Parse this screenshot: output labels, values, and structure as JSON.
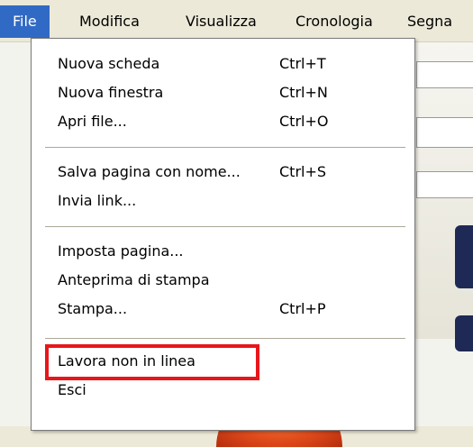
{
  "menubar": {
    "items": [
      {
        "label": "File"
      },
      {
        "label": "Modifica"
      },
      {
        "label": "Visualizza"
      },
      {
        "label": "Cronologia"
      },
      {
        "label": "Segna"
      }
    ]
  },
  "file_menu": {
    "groups": [
      [
        {
          "label": "Nuova scheda",
          "shortcut": "Ctrl+T"
        },
        {
          "label": "Nuova finestra",
          "shortcut": "Ctrl+N"
        },
        {
          "label": "Apri file...",
          "shortcut": "Ctrl+O"
        }
      ],
      [
        {
          "label": "Salva pagina con nome...",
          "shortcut": "Ctrl+S"
        },
        {
          "label": "Invia link...",
          "shortcut": ""
        }
      ],
      [
        {
          "label": "Imposta pagina...",
          "shortcut": ""
        },
        {
          "label": "Anteprima di stampa",
          "shortcut": ""
        },
        {
          "label": "Stampa...",
          "shortcut": "Ctrl+P"
        }
      ],
      [
        {
          "label": "Lavora non in linea",
          "shortcut": ""
        },
        {
          "label": "Esci",
          "shortcut": ""
        }
      ]
    ],
    "highlighted_item": "Lavora non in linea",
    "highlight_color": "#e8161a"
  },
  "colors": {
    "menubar_active": "#316ac5",
    "menubar_bg": "#ece9d8"
  }
}
